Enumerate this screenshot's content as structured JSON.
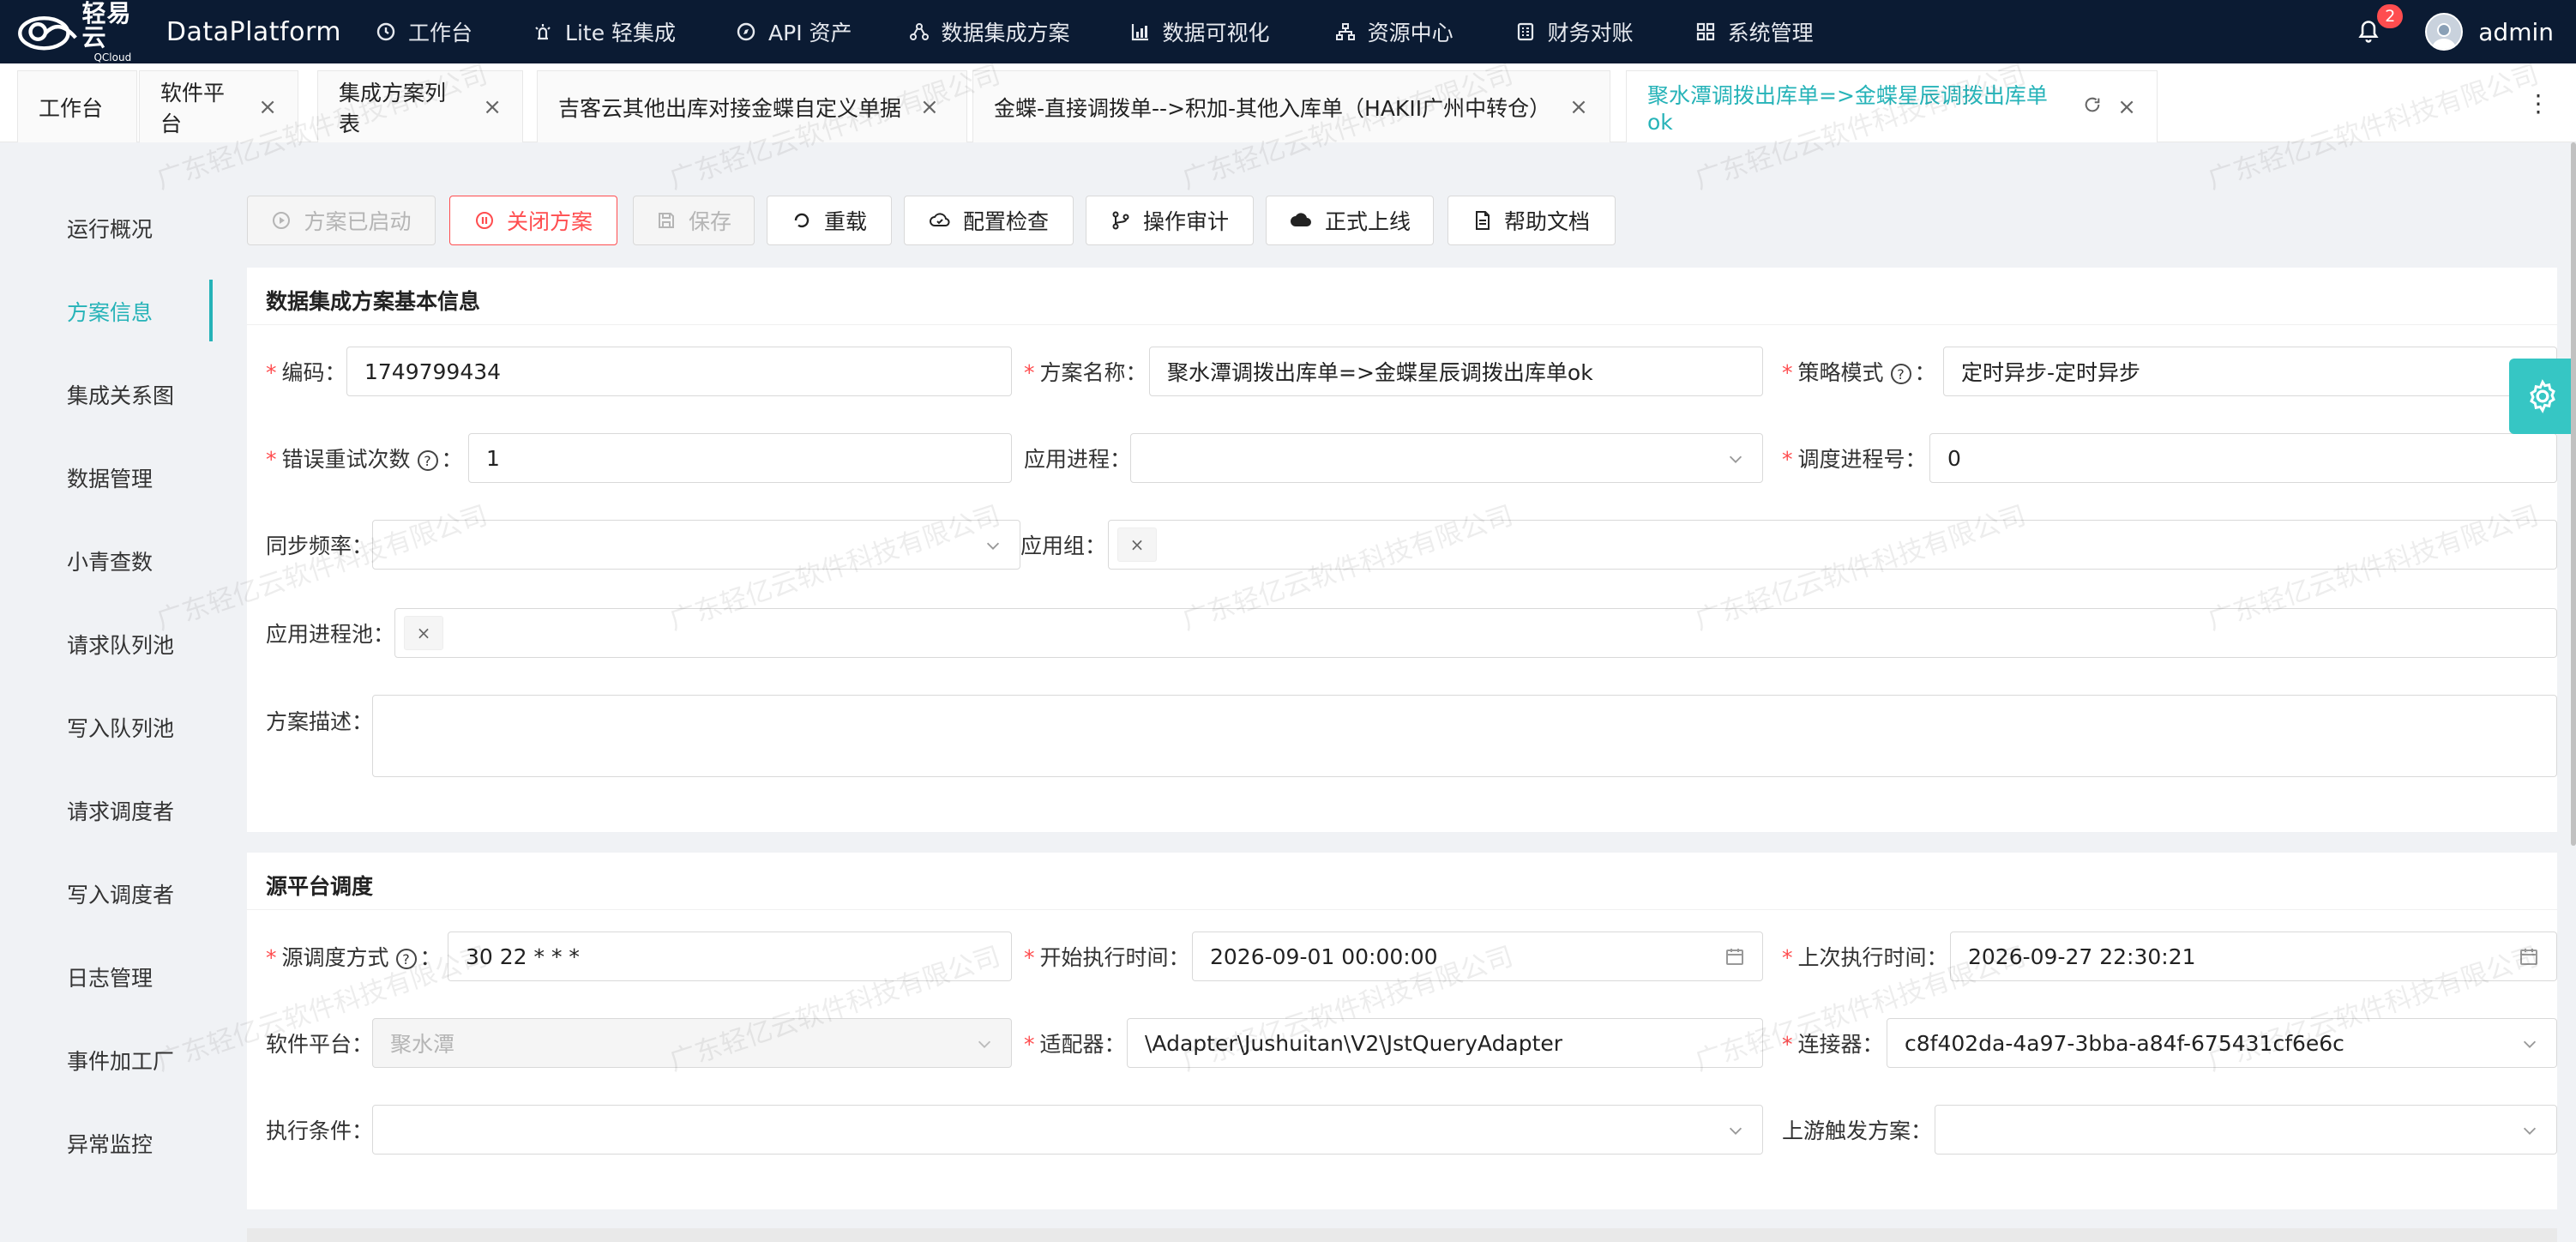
{
  "brand": {
    "name_cn": "轻易云",
    "name_en": "QCloud",
    "title": "DataPlatform"
  },
  "nav": [
    {
      "label": "工作台",
      "icon": "clock-icon"
    },
    {
      "label": "Lite 轻集成",
      "icon": "lamp-icon"
    },
    {
      "label": "API 资产",
      "icon": "compass-icon"
    },
    {
      "label": "数据集成方案",
      "icon": "nodes-icon"
    },
    {
      "label": "数据可视化",
      "icon": "bar-chart-icon"
    },
    {
      "label": "资源中心",
      "icon": "tree-icon"
    },
    {
      "label": "财务对账",
      "icon": "ledger-icon"
    },
    {
      "label": "系统管理",
      "icon": "grid-icon"
    }
  ],
  "notifications": {
    "count": "2"
  },
  "user": {
    "name": "admin"
  },
  "tabs": [
    {
      "label": "工作台"
    },
    {
      "label": "软件平台"
    },
    {
      "label": "集成方案列表"
    },
    {
      "label": "吉客云其他出库对接金蝶自定义单据"
    },
    {
      "label": "金蝶-直接调拨单-->积加-其他入库单（HAKII广州中转仓）"
    },
    {
      "label": "聚水潭调拨出库单=>金蝶星辰调拨出库单ok"
    }
  ],
  "sidebar": [
    {
      "label": "运行概况"
    },
    {
      "label": "方案信息"
    },
    {
      "label": "集成关系图"
    },
    {
      "label": "数据管理"
    },
    {
      "label": "小青查数"
    },
    {
      "label": "请求队列池"
    },
    {
      "label": "写入队列池"
    },
    {
      "label": "请求调度者"
    },
    {
      "label": "写入调度者"
    },
    {
      "label": "日志管理"
    },
    {
      "label": "事件加工厂"
    },
    {
      "label": "异常监控"
    }
  ],
  "toolbar": {
    "started": "方案已启动",
    "close": "关闭方案",
    "save": "保存",
    "reload": "重载",
    "config_check": "配置检查",
    "audit": "操作审计",
    "publish": "正式上线",
    "help": "帮助文档"
  },
  "basic": {
    "title": "数据集成方案基本信息",
    "code_label": "编码",
    "code_value": "1749799434",
    "name_label": "方案名称",
    "name_value": "聚水潭调拨出库单=>金蝶星辰调拨出库单ok",
    "strategy_label": "策略模式",
    "strategy_value": "定时异步-定时异步",
    "retry_label": "错误重试次数",
    "retry_value": "1",
    "app_process_label": "应用进程",
    "app_process_value": "",
    "schedule_no_label": "调度进程号",
    "schedule_no_value": "0",
    "sync_freq_label": "同步频率",
    "sync_freq_value": "",
    "app_group_label": "应用组",
    "app_pool_label": "应用进程池",
    "desc_label": "方案描述",
    "desc_value": ""
  },
  "source": {
    "title": "源平台调度",
    "mode_label": "源调度方式",
    "mode_value": "30 22 * * *",
    "start_label": "开始执行时间",
    "start_value": "2026-09-01 00:00:00",
    "last_label": "上次执行时间",
    "last_value": "2026-09-27 22:30:21",
    "platform_label": "软件平台",
    "platform_value": "聚水潭",
    "adapter_label": "适配器",
    "adapter_value": "\\Adapter\\Jushuitan\\V2\\JstQueryAdapter",
    "connector_label": "连接器",
    "connector_value": "c8f402da-4a97-3bba-a84f-675431cf6e6c",
    "condition_label": "执行条件",
    "condition_value": "",
    "upstream_label": "上游触发方案",
    "upstream_value": ""
  },
  "watermark": "广东轻亿云软件科技有限公司",
  "colors": {
    "accent": "#26b3b8",
    "topbar": "#0b1b33",
    "danger": "#ff4d4f"
  }
}
